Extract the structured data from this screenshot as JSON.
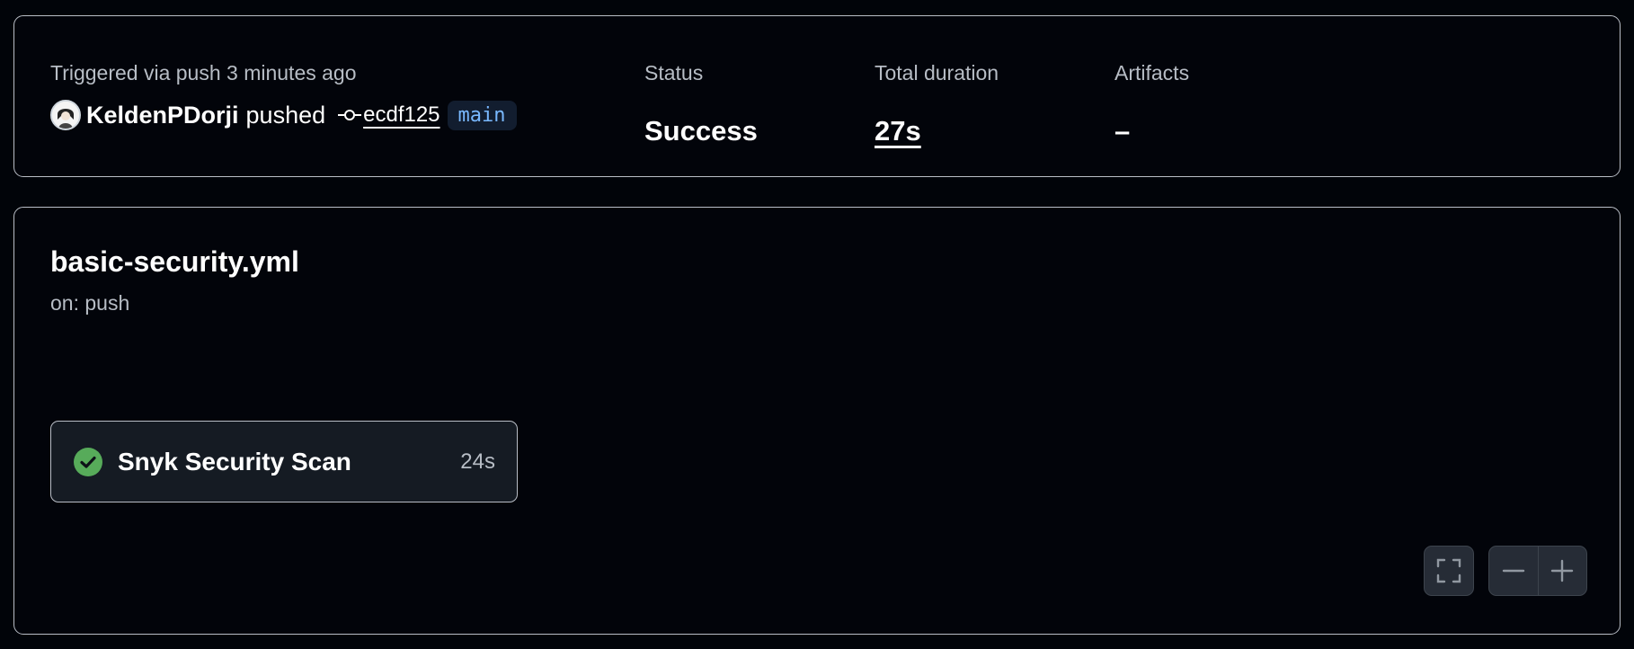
{
  "summary": {
    "trigger_label": "Triggered via push 3 minutes ago",
    "actor": "KeldenPDorji",
    "action": "pushed",
    "commit_sha": "ecdf125",
    "branch": "main",
    "status_label": "Status",
    "status_value": "Success",
    "duration_label": "Total duration",
    "duration_value": "27s",
    "artifacts_label": "Artifacts",
    "artifacts_value": "–"
  },
  "workflow": {
    "file_name": "basic-security.yml",
    "trigger": "on: push",
    "jobs": [
      {
        "name": "Snyk Security Scan",
        "duration": "24s",
        "status": "success",
        "status_icon": "check-circle-icon"
      }
    ]
  },
  "graph_controls": {
    "fullscreen_icon": "fullscreen-icon",
    "zoom_out_icon": "minus-icon",
    "zoom_in_icon": "plus-icon"
  },
  "colors": {
    "background": "#010409",
    "border": "#b9bec6",
    "success": "#57ab5a",
    "branch_text": "#79b8ff",
    "branch_bg": "#121d2f"
  }
}
